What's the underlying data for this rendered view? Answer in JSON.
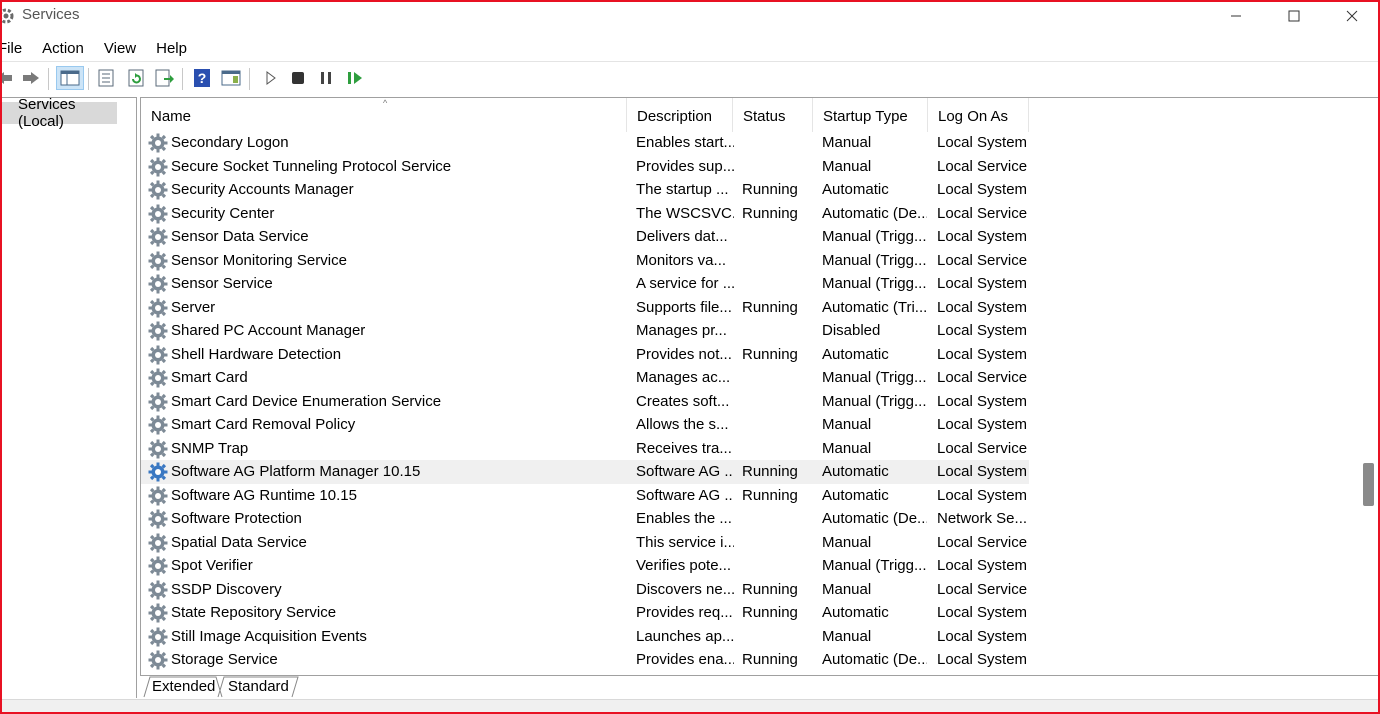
{
  "window": {
    "title": "Services"
  },
  "menu": [
    "File",
    "Action",
    "View",
    "Help"
  ],
  "toolbar": {
    "icons": [
      "back-arrow-icon",
      "forward-arrow-icon",
      "show-console-tree-icon",
      "properties-icon",
      "refresh-icon",
      "export-list-icon",
      "help-icon",
      "show-action-pane-icon",
      "start-service-icon",
      "stop-service-icon",
      "pause-service-icon",
      "resume-service-icon"
    ]
  },
  "tree": {
    "label": "Services (Local)"
  },
  "columns": {
    "name": "Name",
    "description": "Description",
    "status": "Status",
    "startup": "Startup Type",
    "logon": "Log On As"
  },
  "rows": [
    {
      "name": "Secondary Logon",
      "description": "Enables start...",
      "status": "",
      "startup": "Manual",
      "logon": "Local System"
    },
    {
      "name": "Secure Socket Tunneling Protocol Service",
      "description": "Provides sup...",
      "status": "",
      "startup": "Manual",
      "logon": "Local Service"
    },
    {
      "name": "Security Accounts Manager",
      "description": "The startup ...",
      "status": "Running",
      "startup": "Automatic",
      "logon": "Local System"
    },
    {
      "name": "Security Center",
      "description": "The WSCSVC...",
      "status": "Running",
      "startup": "Automatic (De...",
      "logon": "Local Service"
    },
    {
      "name": "Sensor Data Service",
      "description": "Delivers dat...",
      "status": "",
      "startup": "Manual (Trigg...",
      "logon": "Local System"
    },
    {
      "name": "Sensor Monitoring Service",
      "description": "Monitors va...",
      "status": "",
      "startup": "Manual (Trigg...",
      "logon": "Local Service"
    },
    {
      "name": "Sensor Service",
      "description": "A service for ...",
      "status": "",
      "startup": "Manual (Trigg...",
      "logon": "Local System"
    },
    {
      "name": "Server",
      "description": "Supports file...",
      "status": "Running",
      "startup": "Automatic (Tri...",
      "logon": "Local System"
    },
    {
      "name": "Shared PC Account Manager",
      "description": "Manages pr...",
      "status": "",
      "startup": "Disabled",
      "logon": "Local System"
    },
    {
      "name": "Shell Hardware Detection",
      "description": "Provides not...",
      "status": "Running",
      "startup": "Automatic",
      "logon": "Local System"
    },
    {
      "name": "Smart Card",
      "description": "Manages ac...",
      "status": "",
      "startup": "Manual (Trigg...",
      "logon": "Local Service"
    },
    {
      "name": "Smart Card Device Enumeration Service",
      "description": "Creates soft...",
      "status": "",
      "startup": "Manual (Trigg...",
      "logon": "Local System"
    },
    {
      "name": "Smart Card Removal Policy",
      "description": "Allows the s...",
      "status": "",
      "startup": "Manual",
      "logon": "Local System"
    },
    {
      "name": "SNMP Trap",
      "description": "Receives tra...",
      "status": "",
      "startup": "Manual",
      "logon": "Local Service"
    },
    {
      "name": "Software AG Platform Manager 10.15",
      "description": "Software AG ...",
      "status": "Running",
      "startup": "Automatic",
      "logon": "Local System",
      "highlight": true
    },
    {
      "name": "Software AG Runtime 10.15",
      "description": "Software AG ...",
      "status": "Running",
      "startup": "Automatic",
      "logon": "Local System"
    },
    {
      "name": "Software Protection",
      "description": "Enables the ...",
      "status": "",
      "startup": "Automatic (De...",
      "logon": "Network Se..."
    },
    {
      "name": "Spatial Data Service",
      "description": "This service i...",
      "status": "",
      "startup": "Manual",
      "logon": "Local Service"
    },
    {
      "name": "Spot Verifier",
      "description": "Verifies pote...",
      "status": "",
      "startup": "Manual (Trigg...",
      "logon": "Local System"
    },
    {
      "name": "SSDP Discovery",
      "description": "Discovers ne...",
      "status": "Running",
      "startup": "Manual",
      "logon": "Local Service"
    },
    {
      "name": "State Repository Service",
      "description": "Provides req...",
      "status": "Running",
      "startup": "Automatic",
      "logon": "Local System"
    },
    {
      "name": "Still Image Acquisition Events",
      "description": "Launches ap...",
      "status": "",
      "startup": "Manual",
      "logon": "Local System"
    },
    {
      "name": "Storage Service",
      "description": "Provides ena...",
      "status": "Running",
      "startup": "Automatic (De...",
      "logon": "Local System"
    }
  ],
  "tabs": {
    "extended": "Extended",
    "standard": "Standard"
  },
  "colors": {
    "frame": "#e81123",
    "selection": "#cce4f7",
    "highlight_row": "#f0f0f0"
  }
}
